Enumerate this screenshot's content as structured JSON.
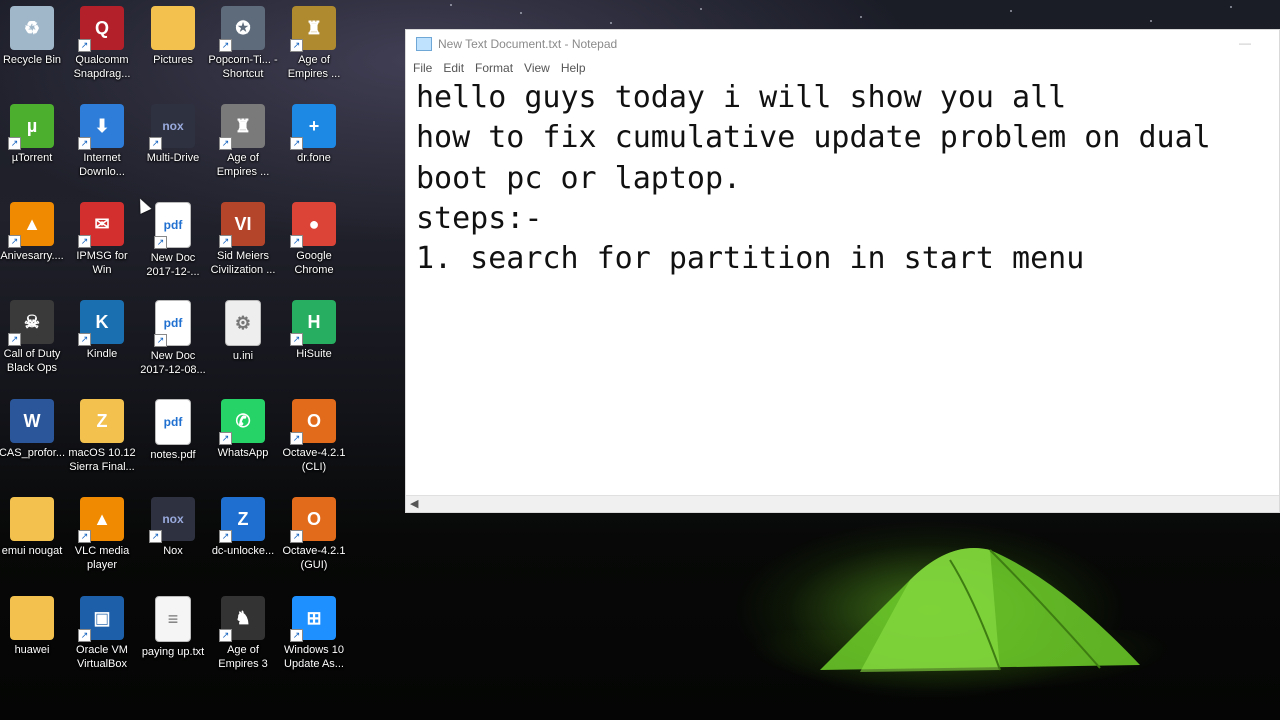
{
  "desktop_icons": [
    {
      "label": "Recycle Bin",
      "icon": "recycle-bin-icon",
      "color": "#9fb7c9"
    },
    {
      "label": "Qualcomm Snapdrag...",
      "icon": "qualcomm-icon",
      "color": "#b3202a"
    },
    {
      "label": "Pictures",
      "icon": "folder-icon",
      "color": "#f2c14e"
    },
    {
      "label": "Popcorn-Ti... - Shortcut",
      "icon": "popcorn-icon",
      "color": "#5d6b7b"
    },
    {
      "label": "Age of Empires ...",
      "icon": "age-of-empires-icon",
      "color": "#b08a2e"
    },
    {
      "label": "µTorrent",
      "icon": "utorrent-icon",
      "color": "#4caf2e"
    },
    {
      "label": "Internet Downlo...",
      "icon": "internet-download-manager-icon",
      "color": "#2e7dd8"
    },
    {
      "label": "Multi-Drive",
      "icon": "nox-icon",
      "color": "#2e3140"
    },
    {
      "label": "Age of Empires ...",
      "icon": "age-of-empires-icon",
      "color": "#7a7a7a"
    },
    {
      "label": "dr.fone",
      "icon": "drfone-icon",
      "color": "#1e88e5"
    },
    {
      "label": "Anivesarry....",
      "icon": "vlc-icon",
      "color": "#f08a00"
    },
    {
      "label": "IPMSG for Win",
      "icon": "ipmsg-icon",
      "color": "#d32f2f"
    },
    {
      "label": "New Doc 2017-12-...",
      "icon": "pdf-icon",
      "color": "#ffffff"
    },
    {
      "label": "Sid Meiers Civilization ...",
      "icon": "civilization-icon",
      "color": "#b5452a"
    },
    {
      "label": "Google Chrome",
      "icon": "chrome-icon",
      "color": "#db4437"
    },
    {
      "label": "Call of Duty Black Ops",
      "icon": "call-of-duty-icon",
      "color": "#3a3a3a"
    },
    {
      "label": "Kindle",
      "icon": "kindle-icon",
      "color": "#1a6fb0"
    },
    {
      "label": "New Doc 2017-12-08...",
      "icon": "pdf-icon",
      "color": "#ffffff"
    },
    {
      "label": "u.ini",
      "icon": "settings-file-icon",
      "color": "#eeeeee"
    },
    {
      "label": "HiSuite",
      "icon": "hisuite-icon",
      "color": "#27ae60"
    },
    {
      "label": "CAS_profor...",
      "icon": "word-doc-icon",
      "color": "#2b579a"
    },
    {
      "label": "macOS 10.12 Sierra Final...",
      "icon": "zip-folder-icon",
      "color": "#f2c14e"
    },
    {
      "label": "notes.pdf",
      "icon": "pdf-icon",
      "color": "#ffffff"
    },
    {
      "label": "WhatsApp",
      "icon": "whatsapp-icon",
      "color": "#25d366"
    },
    {
      "label": "Octave-4.2.1 (CLI)",
      "icon": "octave-icon",
      "color": "#e26a1b"
    },
    {
      "label": "emui nougat",
      "icon": "folder-icon",
      "color": "#f2c14e"
    },
    {
      "label": "VLC media player",
      "icon": "vlc-icon",
      "color": "#f08a00"
    },
    {
      "label": "Nox",
      "icon": "nox-icon",
      "color": "#2e3140"
    },
    {
      "label": "dc-unlocke...",
      "icon": "archive-icon",
      "color": "#1e6fcf"
    },
    {
      "label": "Octave-4.2.1 (GUI)",
      "icon": "octave-icon",
      "color": "#e26a1b"
    },
    {
      "label": "huawei",
      "icon": "folder-icon",
      "color": "#f2c14e"
    },
    {
      "label": "Oracle VM VirtualBox",
      "icon": "virtualbox-icon",
      "color": "#1d5fa8"
    },
    {
      "label": "paying up.txt",
      "icon": "text-file-icon",
      "color": "#f5f5f5"
    },
    {
      "label": "Age of Empires 3",
      "icon": "age-of-empires-3-icon",
      "color": "#333333"
    },
    {
      "label": "Windows 10 Update As...",
      "icon": "windows-icon",
      "color": "#1e90ff"
    }
  ],
  "notepad": {
    "title": "New Text Document.txt - Notepad",
    "menu": [
      "File",
      "Edit",
      "Format",
      "View",
      "Help"
    ],
    "content": "hello guys today i will show you all\nhow to fix cumulative update problem on dual\nboot pc or laptop.\nsteps:-\n1. search for partition in start menu"
  }
}
